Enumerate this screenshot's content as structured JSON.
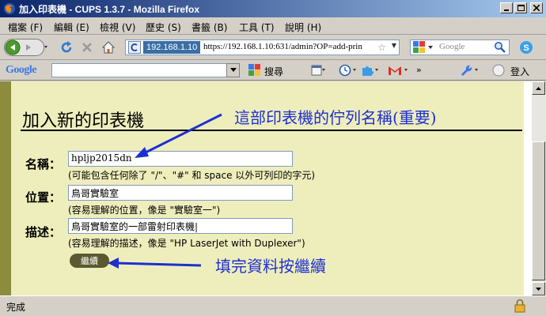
{
  "window": {
    "title": "加入印表機 - CUPS 1.3.7 - Mozilla Firefox"
  },
  "menu": [
    {
      "label": "檔案 (F)"
    },
    {
      "label": "編輯 (E)"
    },
    {
      "label": "檢視 (V)"
    },
    {
      "label": "歷史 (S)"
    },
    {
      "label": "書籤 (B)"
    },
    {
      "label": "工具 (T)"
    },
    {
      "label": "說明 (H)"
    }
  ],
  "urlbar": {
    "site": "192.168.1.10",
    "url": "https://192.168.1.10:631/admin?OP=add-prin"
  },
  "search": {
    "placeholder": "Google"
  },
  "google_toolbar": {
    "logo": "Google",
    "search_label": "搜尋",
    "login_label": "登入"
  },
  "page": {
    "heading": "加入新的印表機",
    "fields": [
      {
        "label": "名稱：",
        "value": "hpljp2015dn",
        "hint": "(可能包含任何除了 \"/\"、\"#\" 和 space 以外可列印的字元)"
      },
      {
        "label": "位置：",
        "value": "鳥哥實驗室",
        "hint": "(容易理解的位置，像是 \"實驗室一\")"
      },
      {
        "label": "描述：",
        "value": "鳥哥實驗室的一部雷射印表機|",
        "hint": "(容易理解的描述，像是 \"HP LaserJet with Duplexer\")"
      }
    ],
    "continue_button": "繼續"
  },
  "annotations": {
    "queue_name": "這部印表機的佇列名稱(重要)",
    "press_continue": "填完資料按繼續"
  },
  "status": {
    "text": "完成"
  },
  "colors": {
    "annotation": "#1e2fd0",
    "panel": "#eeeebd",
    "button": "#5a5a30"
  }
}
